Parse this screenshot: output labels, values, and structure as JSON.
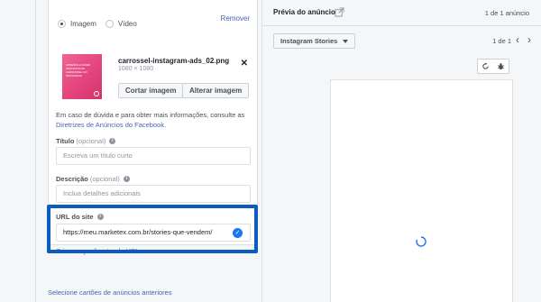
{
  "form": {
    "media_type_options": [
      {
        "label": "Imagem",
        "selected": true
      },
      {
        "label": "Vídeo",
        "selected": false
      }
    ],
    "remove_label": "Remover",
    "image": {
      "filename": "carrossel-instagram-ads_02.png",
      "dimensions": "1080 × 1080",
      "thumbnail_text": "APRENDA A FAZER ANUNCIOS DE CARROSSEL NO INSTAGRAM"
    },
    "crop_button": "Cortar imagem",
    "change_button": "Alterar imagem",
    "help_text": "Em caso de dúvida e para obter mais informações, consulte as",
    "help_link": "Diretrizes de Anúncios do Facebook.",
    "title_field": {
      "label": "Título",
      "optional": "(opcional)",
      "placeholder": "Escreva um título curto"
    },
    "description_field": {
      "label": "Descrição",
      "optional": "(opcional)",
      "placeholder": "Inclua detalhes adicionais"
    },
    "url_field": {
      "label": "URL do site",
      "value": "https://meu.marketex.com.br/stories-que-vendem/"
    },
    "param_link": "Criar um parâmetro de URL",
    "bottom_link": "Selecione cartões de anúncios anteriores",
    "highlight_color": "#0b5cbf"
  },
  "preview": {
    "title": "Prévia do anúncio",
    "count_top": "1 de 1 anúncio",
    "placement": "Instagram Stories",
    "page_count": "1 de 1",
    "accent": "#1877f2"
  }
}
